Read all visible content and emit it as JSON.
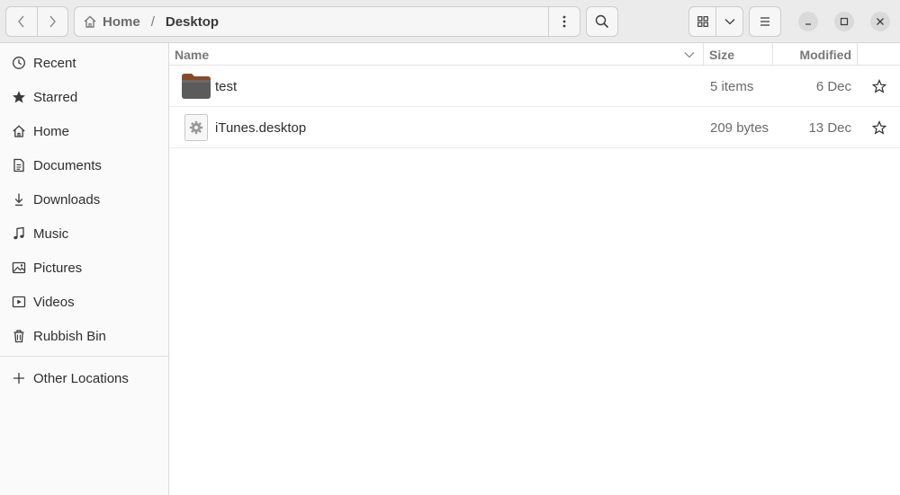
{
  "window": {
    "title": "Desktop"
  },
  "pathbar": {
    "home_label": "Home",
    "separator": "/",
    "current": "Desktop"
  },
  "sidebar": {
    "items": [
      {
        "label": "Recent",
        "icon": "clock-icon"
      },
      {
        "label": "Starred",
        "icon": "star-icon"
      },
      {
        "label": "Home",
        "icon": "home-icon"
      },
      {
        "label": "Documents",
        "icon": "document-icon"
      },
      {
        "label": "Downloads",
        "icon": "download-icon"
      },
      {
        "label": "Music",
        "icon": "music-note-icon"
      },
      {
        "label": "Pictures",
        "icon": "picture-icon"
      },
      {
        "label": "Videos",
        "icon": "video-icon"
      },
      {
        "label": "Rubbish Bin",
        "icon": "trash-icon"
      }
    ],
    "other_locations": {
      "label": "Other Locations",
      "icon": "plus-icon"
    }
  },
  "columns": {
    "name": "Name",
    "size": "Size",
    "modified": "Modified"
  },
  "files": [
    {
      "name": "test",
      "size": "5 items",
      "modified": "6 Dec",
      "type": "folder",
      "starred": false
    },
    {
      "name": "iTunes.desktop",
      "size": "209 bytes",
      "modified": "13 Dec",
      "type": "desktop-file",
      "starred": false
    }
  ],
  "colors": {
    "header_bg": "#ebebeb",
    "sidebar_bg": "#fafafa",
    "folder_brown": "#8a4a24",
    "folder_body": "#5b5b5b"
  }
}
